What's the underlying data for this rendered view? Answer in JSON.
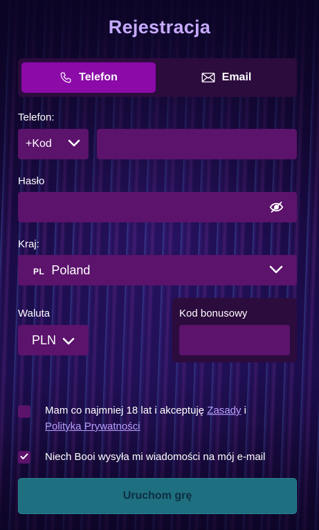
{
  "title": "Rejestracja",
  "tabs": [
    {
      "label": "Telefon",
      "icon": "phone-icon",
      "active": true
    },
    {
      "label": "Email",
      "icon": "envelope-icon",
      "active": false
    }
  ],
  "phone": {
    "label": "Telefon:",
    "code_value": "+Kod",
    "number_value": ""
  },
  "password": {
    "label": "Hasło",
    "value": ""
  },
  "country": {
    "label": "Kraj:",
    "flag_code": "PL",
    "value": "Poland"
  },
  "currency": {
    "label": "Waluta",
    "value": "PLN"
  },
  "bonus": {
    "label": "Kod bonusowy",
    "value": ""
  },
  "consent": {
    "text_before": "Mam co najmniej 18 lat i akceptuję ",
    "terms_link": "Zasady",
    "text_and": " i",
    "privacy_link": "Polityka Prywatności",
    "checked": false
  },
  "newsletter": {
    "text": "Niech Booi wysyła mi wiadomości na mój e-mail",
    "checked": true
  },
  "submit_label": "Uruchom grę",
  "colors": {
    "accent": "#8b0aa8",
    "field_bg": "#5b136b",
    "title": "#c6aaff",
    "submit_bg": "#1e6f80"
  }
}
